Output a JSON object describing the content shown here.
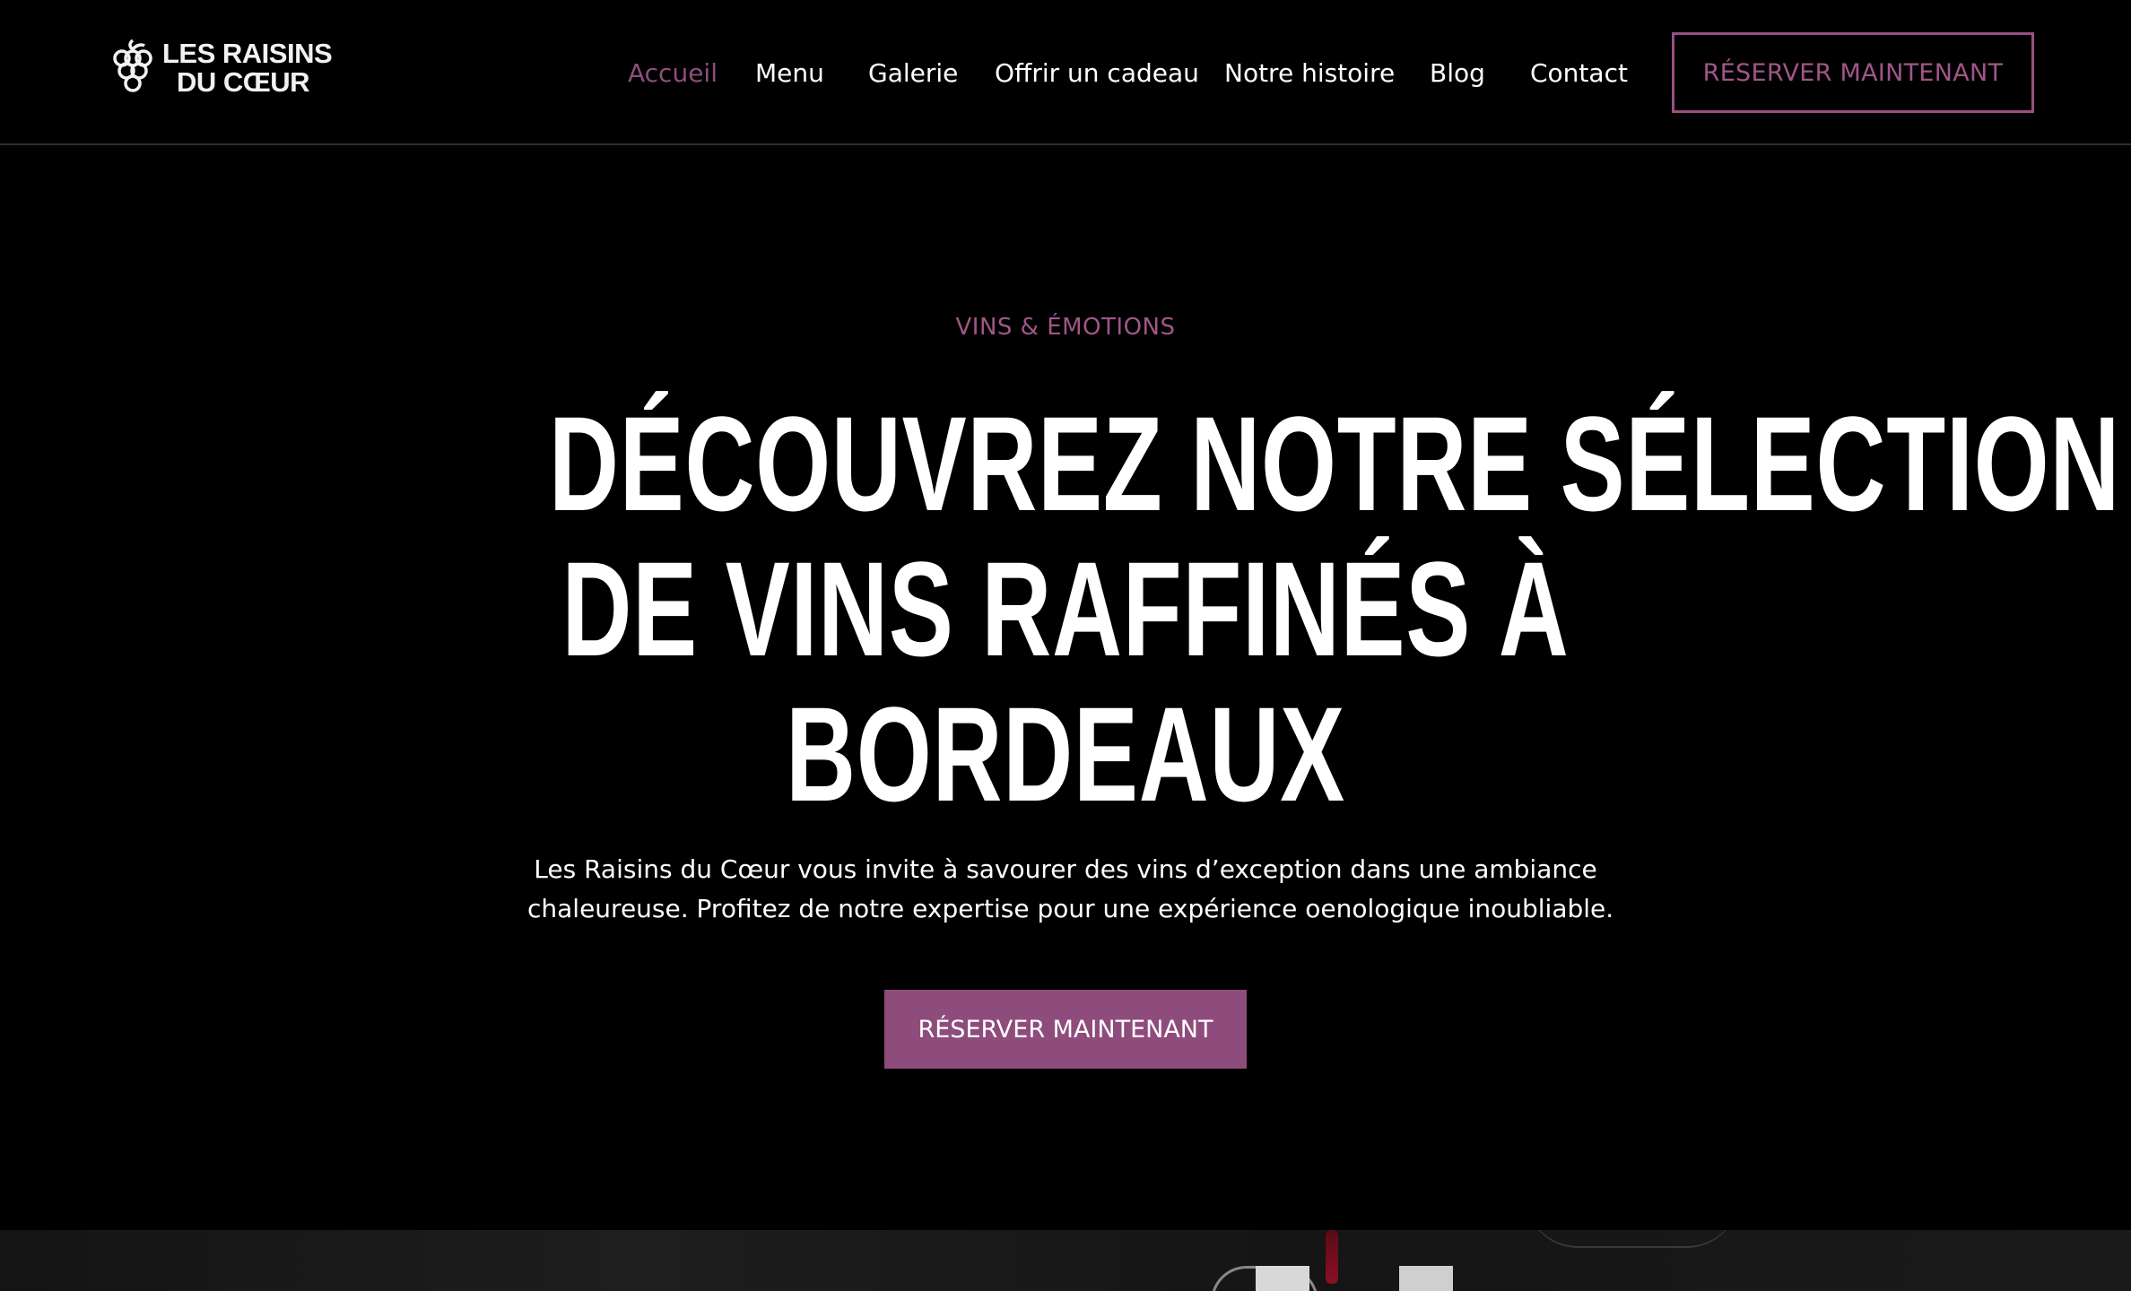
{
  "brand": {
    "logo_line1": "LES RAISINS",
    "logo_line2": "DU CŒUR",
    "accent_color": "#9a4e83"
  },
  "nav": {
    "items": [
      {
        "label": "Accueil",
        "active": true
      },
      {
        "label": "Menu",
        "active": false
      },
      {
        "label": "Galerie",
        "active": false
      },
      {
        "label": "Offrir un cadeau",
        "active": false
      },
      {
        "label": "Notre histoire",
        "active": false
      },
      {
        "label": "Blog",
        "active": false
      },
      {
        "label": "Contact",
        "active": false
      }
    ],
    "cta_label": "RÉSERVER MAINTENANT"
  },
  "hero": {
    "eyebrow": "VINS & ÉMOTIONS",
    "headline_lines": [
      "DÉCOUVREZ NOTRE SÉLECTION",
      "DE VINS RAFFINÉS À",
      "BORDEAUX"
    ],
    "subtext_lines": [
      "Les Raisins du Cœur vous invite à savourer des vins d’exception dans une ambiance",
      "chaleureuse. Profitez de notre expertise pour une expérience oenologique inoubliable."
    ],
    "cta_label": "RÉSERVER MAINTENANT"
  }
}
